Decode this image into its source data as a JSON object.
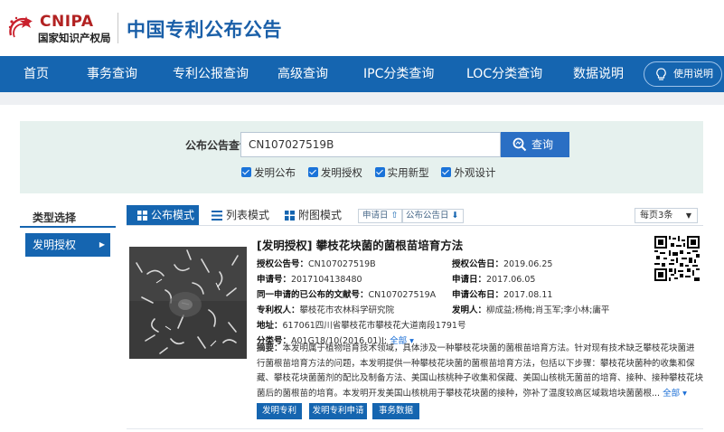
{
  "header": {
    "logo_en": "CNIPA",
    "logo_cn": "国家知识产权局",
    "site_title": "中国专利公布公告"
  },
  "nav": {
    "items": [
      {
        "label": "首页"
      },
      {
        "label": "事务查询"
      },
      {
        "label": "专利公报查询"
      },
      {
        "label": "高级查询"
      },
      {
        "label": "IPC分类查询"
      },
      {
        "label": "LOC分类查询"
      },
      {
        "label": "数据说明"
      }
    ],
    "help_label": "使用说明"
  },
  "search": {
    "label": "公布公告查询",
    "value": "CN107027519B",
    "button_label": "查询",
    "filters": [
      {
        "label": "发明公布",
        "checked": true
      },
      {
        "label": "发明授权",
        "checked": true
      },
      {
        "label": "实用新型",
        "checked": true
      },
      {
        "label": "外观设计",
        "checked": true
      }
    ]
  },
  "sidebar": {
    "heading": "类型选择",
    "items": [
      {
        "label": "发明授权",
        "selected": true
      }
    ]
  },
  "toolbar": {
    "views": [
      {
        "label": "公布模式",
        "active": true,
        "icon": "grid-icon"
      },
      {
        "label": "列表模式",
        "active": false,
        "icon": "list-icon"
      },
      {
        "label": "附图模式",
        "active": false,
        "icon": "tiles-icon"
      }
    ],
    "sort_apply_date": "申请日",
    "sort_pub_date": "公布公告日",
    "per_page": "每页3条"
  },
  "result": {
    "title": "[发明授权] 攀枝花块菌的菌根苗培育方法",
    "pub_no_label": "授权公告号：",
    "pub_no": "CN107027519B",
    "grant_date_label": "授权公告日：",
    "grant_date": "2019.06.25",
    "app_no_label": "申请号：",
    "app_no": "2017104138480",
    "app_date_label": "申请日：",
    "app_date": "2017.06.05",
    "same_app_label": "同一申请的已公布的文献号：",
    "same_app": "CN107027519A",
    "app_pub_date_label": "申请公布日：",
    "app_pub_date": "2017.08.11",
    "patentee_label": "专利权人：",
    "patentee": "攀枝花市农林科学研究院",
    "inventor_label": "发明人：",
    "inventor": "柳成益;杨梅;肖玉军;李小林;庸平",
    "address_label": "地址：",
    "address": "617061四川省攀枝花市攀枝花大道南段1791号",
    "classification_label": "分类号：",
    "classification": "A01G18/10(2016.01)I;",
    "all_label": "全部",
    "abstract_label": "摘要：",
    "abstract_text": "本发明属于植物培育技术领域，具体涉及一种攀枝花块菌的菌根苗培育方法。针对现有技术缺乏攀枝花块菌进行菌根苗培育方法的问题，本发明提供一种攀枝花块菌的菌根苗培育方法，包括以下步骤：攀枝花块菌种的收集和保藏、攀枝花块菌菌剂的配比及制备方法、美国山核桃种子收集和保藏、美国山核桃无菌苗的培育、接种、接种攀枝花块菌后的菌根苗的培育。本发明开发美国山核桃用于攀枝花块菌的接种，弥补了温度较高区域栽培块菌菌根...",
    "abstract_more": "全部",
    "buttons": [
      "发明专利",
      "发明专利申请",
      "事务数据"
    ]
  }
}
